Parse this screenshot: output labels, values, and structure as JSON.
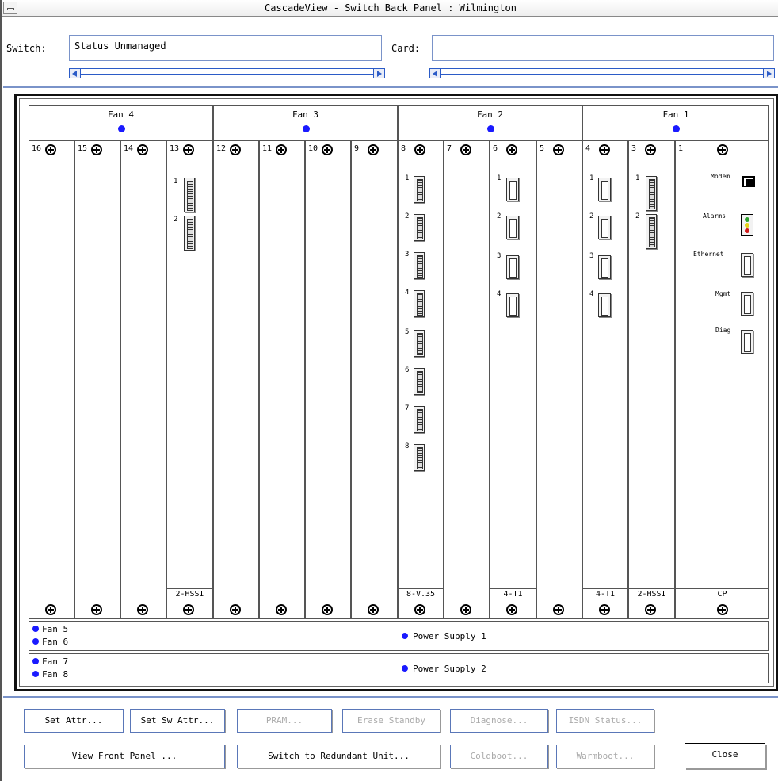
{
  "window": {
    "title": "CascadeView - Switch Back Panel : Wilmington"
  },
  "header": {
    "switch_label": "Switch:",
    "switch_value": "Status Unmanaged",
    "card_label": "Card:",
    "card_value": ""
  },
  "fans": [
    {
      "label": "Fan 4"
    },
    {
      "label": "Fan 3"
    },
    {
      "label": "Fan 2"
    },
    {
      "label": "Fan 1"
    }
  ],
  "slots": [
    {
      "num": "16"
    },
    {
      "num": "15"
    },
    {
      "num": "14"
    },
    {
      "num": "13",
      "card": "2-HSSI",
      "ports": [
        "1",
        "2"
      ]
    },
    {
      "num": "12"
    },
    {
      "num": "11"
    },
    {
      "num": "10"
    },
    {
      "num": "9"
    },
    {
      "num": "8",
      "card": "8-V.35",
      "ports": [
        "1",
        "2",
        "3",
        "4",
        "5",
        "6",
        "7",
        "8"
      ]
    },
    {
      "num": "7"
    },
    {
      "num": "6",
      "card": "4-T1",
      "ports": [
        "1",
        "2",
        "3",
        "4"
      ]
    },
    {
      "num": "5"
    },
    {
      "num": "4",
      "card": "4-T1",
      "ports": [
        "1",
        "2",
        "3",
        "4"
      ]
    },
    {
      "num": "3",
      "card": "2-HSSI",
      "ports": [
        "1",
        "2"
      ]
    },
    {
      "num": "1",
      "card": "CP",
      "ports": [
        "Modem",
        "Alarms",
        "Ethernet",
        "Mgmt",
        "Diag"
      ]
    }
  ],
  "power": [
    {
      "fans": [
        "Fan 5",
        "Fan 6"
      ],
      "label": "Power Supply 1"
    },
    {
      "fans": [
        "Fan 7",
        "Fan 8"
      ],
      "label": "Power Supply 2"
    }
  ],
  "buttons": {
    "set_attr": "Set Attr...",
    "set_sw_attr": "Set Sw Attr...",
    "pram": "PRAM...",
    "erase_standby": "Erase Standby",
    "diagnose": "Diagnose...",
    "isdn_status": "ISDN Status...",
    "view_front_panel": "View Front Panel ...",
    "switch_redundant": "Switch to Redundant Unit...",
    "coldboot": "Coldboot...",
    "warmboot": "Warmboot...",
    "close": "Close"
  },
  "colors": {
    "status_dot": "#1a1aff",
    "accent": "#2b5bc7"
  }
}
